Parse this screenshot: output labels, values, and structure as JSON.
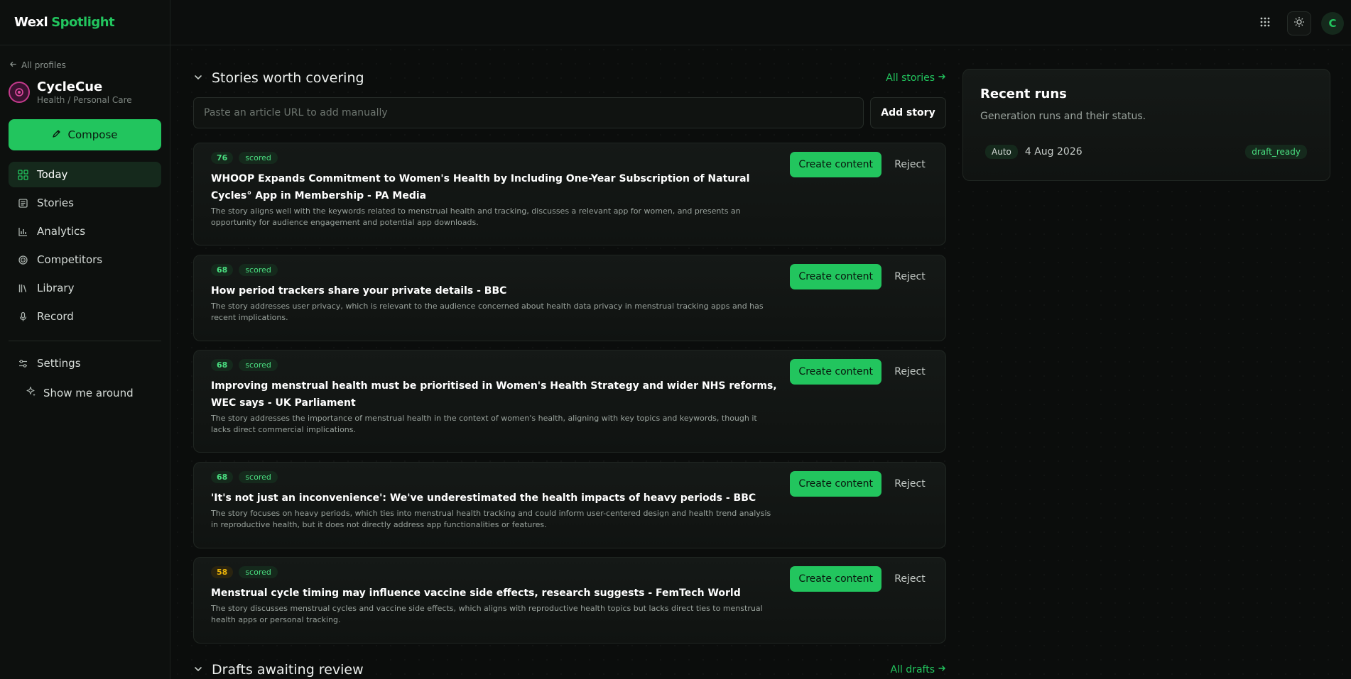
{
  "brand": {
    "part1": "Wexl",
    "part2": "Spotlight"
  },
  "sidebar": {
    "back_label": "All profiles",
    "profile": {
      "name": "CycleCue",
      "category": "Health / Personal Care"
    },
    "compose_label": "Compose",
    "items": [
      {
        "label": "Today",
        "icon": "grid-icon",
        "active": true
      },
      {
        "label": "Stories",
        "icon": "newspaper-icon"
      },
      {
        "label": "Analytics",
        "icon": "bar-chart-icon"
      },
      {
        "label": "Competitors",
        "icon": "radar-icon"
      },
      {
        "label": "Library",
        "icon": "library-icon"
      },
      {
        "label": "Record",
        "icon": "microphone-icon"
      }
    ],
    "settings_label": "Settings",
    "tour_label": "Show me around"
  },
  "topbar": {
    "avatar_initial": "C"
  },
  "stories_section": {
    "title": "Stories worth covering",
    "link_label": "All stories",
    "url_placeholder": "Paste an article URL to add manually",
    "add_label": "Add story"
  },
  "stories": [
    {
      "score": "76",
      "status": "scored",
      "title": "WHOOP Expands Commitment to Women's Health by Including One-Year Subscription of Natural Cycles° App in Membership - PA Media",
      "summary": "The story aligns well with the keywords related to menstrual health and tracking, discusses a relevant app for women, and presents an opportunity for audience engagement and potential app downloads.",
      "create_label": "Create content",
      "reject_label": "Reject"
    },
    {
      "score": "68",
      "status": "scored",
      "title": "How period trackers share your private details - BBC",
      "summary": "The story addresses user privacy, which is relevant to the audience concerned about health data privacy in menstrual tracking apps and has recent implications.",
      "create_label": "Create content",
      "reject_label": "Reject"
    },
    {
      "score": "68",
      "status": "scored",
      "title": "Improving menstrual health must be prioritised in Women's Health Strategy and wider NHS reforms, WEC says - UK Parliament",
      "summary": "The story addresses the importance of menstrual health in the context of women's health, aligning with key topics and keywords, though it lacks direct commercial implications.",
      "create_label": "Create content",
      "reject_label": "Reject"
    },
    {
      "score": "68",
      "status": "scored",
      "title": "'It's not just an inconvenience': We've underestimated the health impacts of heavy periods - BBC",
      "summary": "The story focuses on heavy periods, which ties into menstrual health tracking and could inform user-centered design and health trend analysis in reproductive health, but it does not directly address app functionalities or features.",
      "create_label": "Create content",
      "reject_label": "Reject"
    },
    {
      "score": "58",
      "status": "scored",
      "title": "Menstrual cycle timing may influence vaccine side effects, research suggests - FemTech World",
      "summary": "The story discusses menstrual cycles and vaccine side effects, which aligns with reproductive health topics but lacks direct ties to menstrual health apps or personal tracking.",
      "create_label": "Create content",
      "reject_label": "Reject"
    }
  ],
  "drafts_section": {
    "title": "Drafts awaiting review",
    "link_label": "All drafts"
  },
  "recent_runs": {
    "title": "Recent runs",
    "subtitle": "Generation runs and their status.",
    "runs": [
      {
        "mode": "Auto",
        "date": "4 Aug 2026",
        "status": "draft_ready"
      }
    ]
  },
  "colors": {
    "accent": "#22c55e",
    "background": "#0b0d0c",
    "score_low": "#eab308"
  }
}
